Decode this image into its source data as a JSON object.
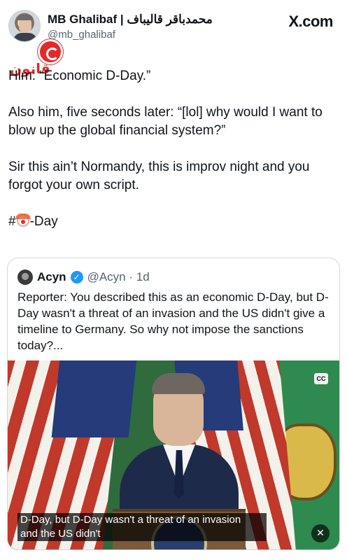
{
  "post": {
    "display_name": "MB Ghalibaf | محمدباقر قالیباف",
    "handle": "@mb_ghalibaf",
    "site": "X.com",
    "watermark": "قانون",
    "paragraphs": [
      "Him: “Economic D-Day.”",
      "Also him, five seconds later: “[lol] why would I want to blow up the global financial system?”",
      "Sir this ain’t Normandy, this is improv night and you forgot your own script."
    ],
    "hashtag_prefix": "#",
    "hashtag_emoji": "clown-face-emoji",
    "hashtag_suffix": "-Day"
  },
  "quoted": {
    "name": "Acyn",
    "meta": "@Acyn · 1d",
    "text": "Reporter: You described this as an economic D-Day, but D-Day wasn't a threat of an invasion and the US didn't give a timeline to Germany. So why not impose the sanctions today?...",
    "video": {
      "cc_label": "CC",
      "caption_line1": "D-Day, but D-Day wasn't a threat of an invasion",
      "caption_line2": "and the US didn't",
      "mute_icon": "speaker-muted-icon"
    }
  },
  "colors": {
    "text": "#0f1419",
    "secondary": "#536471",
    "verified": "#1d9bf0",
    "border": "#cfd9de",
    "watermark": "#e22a2a"
  }
}
